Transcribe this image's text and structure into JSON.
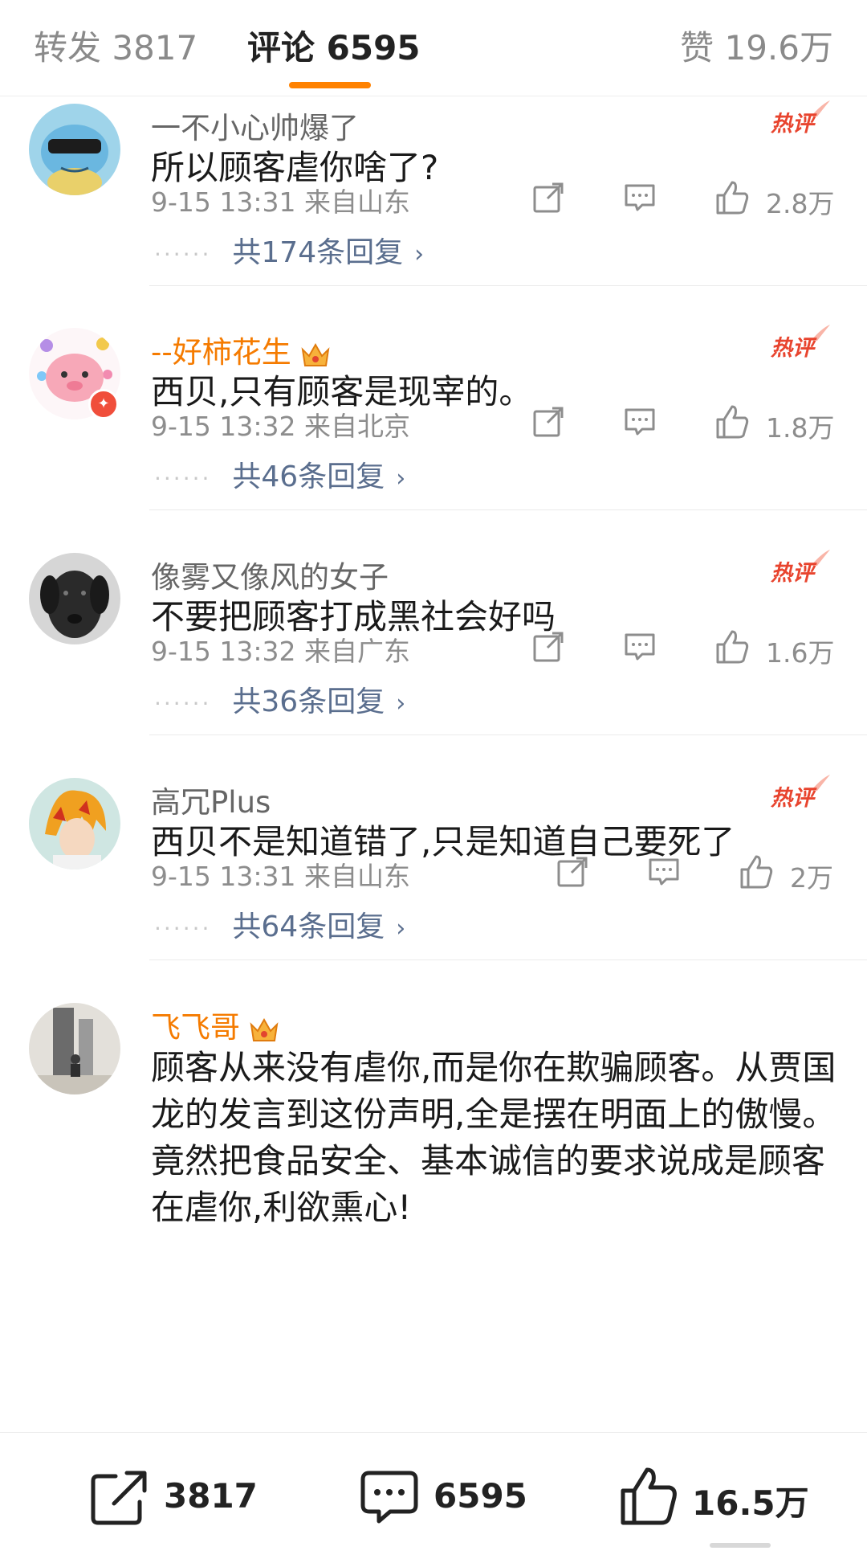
{
  "tabs": {
    "repost": "转发 3817",
    "comment": "评论 6595",
    "likes": "赞 19.6万"
  },
  "hot_label": "热评",
  "comments": [
    {
      "username": "一不小心帅爆了",
      "text": "所以顾客虐你啥了?",
      "meta": "9-15 13:31 来自山东",
      "likes": "2.8万",
      "replies": "共174条回复"
    },
    {
      "username": "--好柿花生",
      "text": "西贝,只有顾客是现宰的。",
      "meta": "9-15 13:32 来自北京",
      "likes": "1.8万",
      "replies": "共46条回复"
    },
    {
      "username": "像雾又像风的女子",
      "text": "不要把顾客打成黑社会好吗",
      "meta": "9-15 13:32 来自广东",
      "likes": "1.6万",
      "replies": "共36条回复"
    },
    {
      "username": "高冗Plus",
      "text": "西贝不是知道错了,只是知道自己要死了",
      "meta": "9-15 13:31 来自山东",
      "likes": "2万",
      "replies": "共64条回复"
    },
    {
      "username": "飞飞哥",
      "text": "顾客从来没有虐你,而是你在欺骗顾客。从贾国龙的发言到这份声明,全是摆在明面上的傲慢。竟然把食品安全、基本诚信的要求说成是顾客在虐你,利欲熏心!"
    }
  ],
  "bottom_bar": {
    "share_count": "3817",
    "comment_count": "6595",
    "like_count": "16.5万"
  },
  "colors": {
    "accent": "#ff8200",
    "vip_name": "#f57b00",
    "hot_badge": "#e8442e",
    "reply_link": "#5a6e8e"
  },
  "icons": [
    "share-icon",
    "comment-icon",
    "thumbs-up-icon",
    "chevron-right-icon",
    "crown-icon",
    "hot-badge-icon"
  ]
}
